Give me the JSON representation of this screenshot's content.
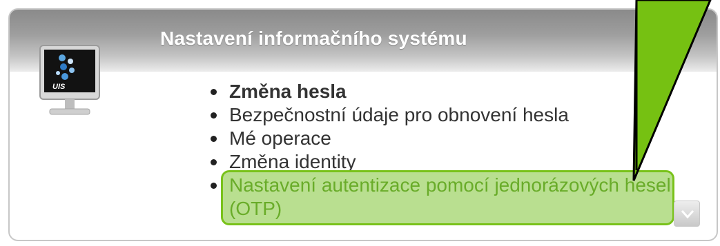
{
  "panel": {
    "title": "Nastavení informačního systému",
    "icon": "monitor-uis-icon",
    "icon_caption": "UIS"
  },
  "menu": {
    "items": [
      {
        "label": "Změna hesla",
        "bold": true
      },
      {
        "label": "Bezpečnostní údaje pro obnovení hesla"
      },
      {
        "label": "Mé operace"
      },
      {
        "label": "Změna identity"
      },
      {
        "label": "Nastavení autentizace pomocí jednorázových hesel (OTP)",
        "highlighted": true
      }
    ]
  },
  "expand_button": {
    "icon": "chevron-down-icon"
  },
  "callout": {
    "icon": "arrow-pointer-icon"
  },
  "colors": {
    "highlight_fill": "#80c434",
    "highlight_border": "#79c21a",
    "highlight_text": "#4f8f1c",
    "arrow_fill": "#76c112",
    "arrow_stroke": "#000000",
    "header_gradient_top": "#8a8a8a"
  }
}
